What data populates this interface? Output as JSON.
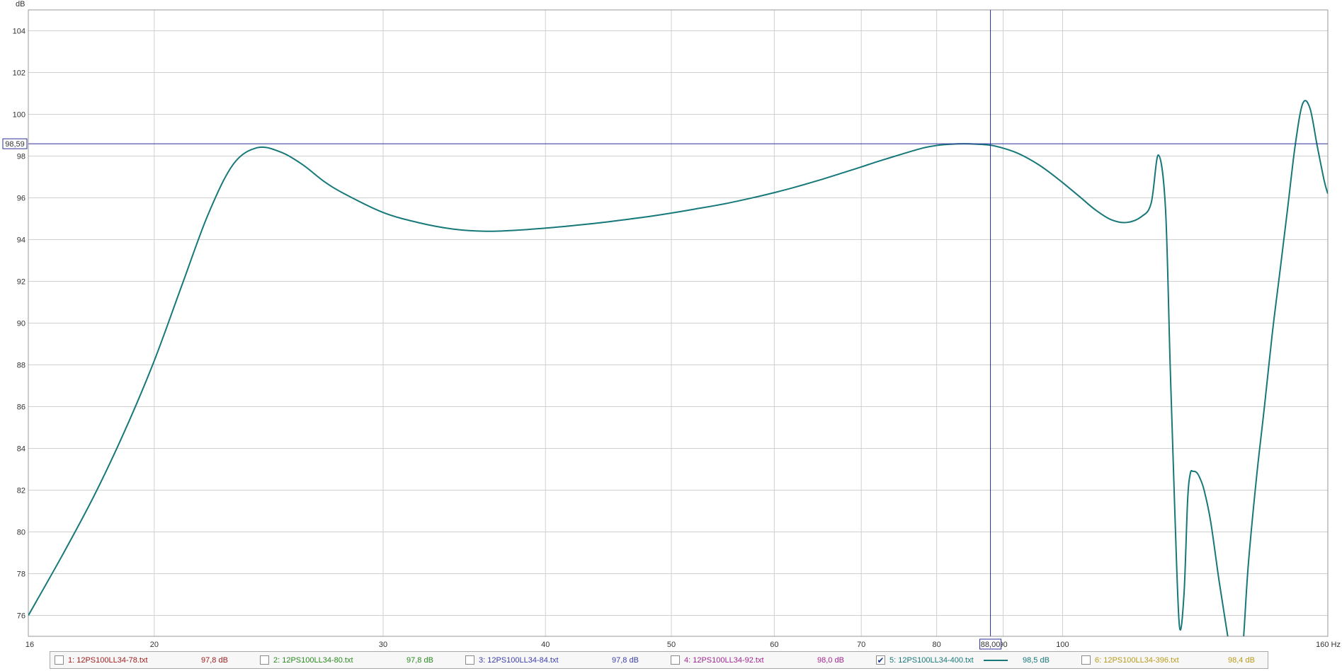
{
  "chart_data": {
    "type": "line",
    "title": "",
    "xlabel": "Hz",
    "ylabel": "dB",
    "x_scale": "log",
    "xlim": [
      16,
      160
    ],
    "ylim": [
      75,
      105
    ],
    "x_ticks": [
      16,
      20,
      30,
      40,
      50,
      60,
      70,
      80,
      90,
      100,
      160
    ],
    "x_tick_labels": [
      "16",
      "20",
      "30",
      "40",
      "50",
      "60",
      "70",
      "80",
      "90",
      "100",
      "160 Hz"
    ],
    "y_ticks": [
      76,
      78,
      80,
      82,
      84,
      86,
      88,
      90,
      92,
      94,
      96,
      98,
      100,
      102,
      104
    ],
    "grid": true,
    "cursor": {
      "x_label": "88,00",
      "y_label": "98,59"
    },
    "series": [
      {
        "name": "5: 12PS100LL34-400.txt",
        "color": "#17787a",
        "x": [
          16,
          17,
          18,
          19,
          20,
          21,
          22,
          23,
          24,
          25,
          26,
          27,
          28,
          30,
          32,
          34,
          36,
          38,
          40,
          42,
          44,
          46,
          48,
          50,
          52,
          55,
          58,
          60,
          62,
          65,
          68,
          70,
          72,
          75,
          78,
          80,
          82,
          84,
          86,
          88,
          90,
          92,
          94,
          96,
          98,
          100,
          103,
          106,
          109,
          112,
          115,
          117,
          118.5,
          120,
          121,
          122,
          123,
          124,
          124.8,
          125.4,
          126,
          126.8,
          127.5,
          128.5,
          130,
          132,
          134,
          136,
          137,
          137.5,
          138,
          139,
          141,
          143,
          145,
          147,
          149,
          151,
          153,
          155,
          157,
          159,
          160
        ],
        "y": [
          76.0,
          78.9,
          81.8,
          84.9,
          88.2,
          91.8,
          95.2,
          97.6,
          98.4,
          98.2,
          97.6,
          96.8,
          96.2,
          95.3,
          94.8,
          94.5,
          94.4,
          94.45,
          94.55,
          94.67,
          94.8,
          94.95,
          95.1,
          95.27,
          95.45,
          95.72,
          96.03,
          96.25,
          96.48,
          96.85,
          97.23,
          97.48,
          97.73,
          98.07,
          98.38,
          98.51,
          98.57,
          98.59,
          98.57,
          98.52,
          98.38,
          98.18,
          97.9,
          97.56,
          97.16,
          96.73,
          96.07,
          95.42,
          94.95,
          94.82,
          95.1,
          95.75,
          98.05,
          95.5,
          88.0,
          81.0,
          75.5,
          77.0,
          81.5,
          82.8,
          82.9,
          82.85,
          82.6,
          82.0,
          80.5,
          77.6,
          75.0,
          72.5,
          72.0,
          74.0,
          75.5,
          78.5,
          82.6,
          86.0,
          89.5,
          92.5,
          95.5,
          98.5,
          100.5,
          100.3,
          98.5,
          96.8,
          96.2
        ]
      }
    ]
  },
  "legend": {
    "items": [
      {
        "label": "1: 12PS100LL34-78.txt",
        "value": "97,8 dB",
        "checked": false,
        "color": "#9e1b1b"
      },
      {
        "label": "2: 12PS100LL34-80.txt",
        "value": "97,8 dB",
        "checked": false,
        "color": "#2a8a20"
      },
      {
        "label": "3: 12PS100LL34-84.txt",
        "value": "97,8 dB",
        "checked": false,
        "color": "#3b3fa8"
      },
      {
        "label": "4: 12PS100LL34-92.txt",
        "value": "98,0 dB",
        "checked": false,
        "color": "#a12592"
      },
      {
        "label": "5: 12PS100LL34-400.txt",
        "value": "98,5 dB",
        "checked": true,
        "color": "#17787a"
      },
      {
        "label": "6: 12PS100LL34-396.txt",
        "value": "98,4 dB",
        "checked": false,
        "color": "#b89a1a"
      }
    ]
  }
}
